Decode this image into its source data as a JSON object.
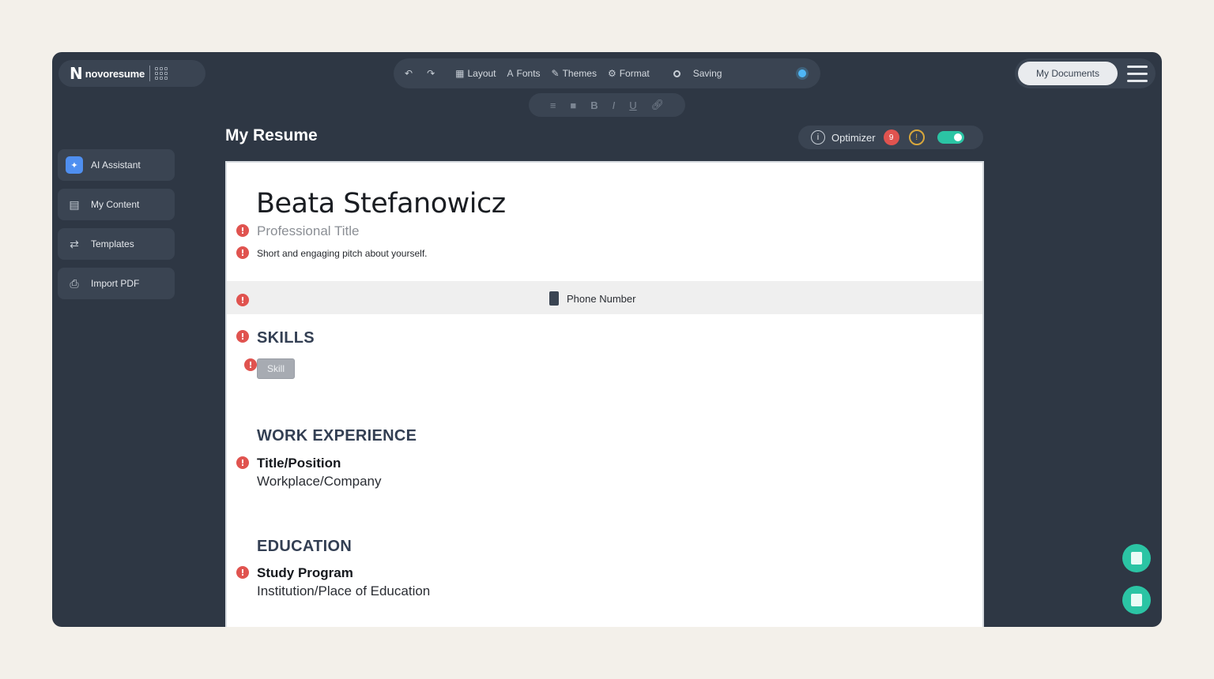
{
  "app": {
    "logo_mark": "N",
    "logo_text": "novoresume"
  },
  "toolbar": {
    "undo_icon": "undo-icon",
    "redo_icon": "redo-icon",
    "layout_label": "Layout",
    "fonts_label": "Fonts",
    "themes_label": "Themes",
    "format_label": "Format",
    "saving_label": "Saving"
  },
  "format_bar": {
    "bold": "B",
    "italic": "I",
    "underline": "U"
  },
  "header_right": {
    "my_documents_label": "My Documents"
  },
  "sidebar": {
    "items": [
      {
        "label": "AI Assistant",
        "icon": "ai-icon"
      },
      {
        "label": "My Content",
        "icon": "content-icon"
      },
      {
        "label": "Templates",
        "icon": "templates-icon"
      },
      {
        "label": "Import PDF",
        "icon": "import-pdf-icon"
      }
    ]
  },
  "main": {
    "title": "My Resume",
    "optimizer_label": "Optimizer",
    "optimizer_error_count": "9",
    "optimizer_warning": "!"
  },
  "resume": {
    "name": "Beata Stefanowicz",
    "professional_title": "Professional Title",
    "pitch": "Short and engaging pitch about yourself.",
    "phone_label": "Phone Number",
    "skills_heading": "SKILLS",
    "skill_chip": "Skill",
    "work_heading": "WORK EXPERIENCE",
    "work_title": "Title/Position",
    "work_company": "Workplace/Company",
    "education_heading": "EDUCATION",
    "edu_program": "Study Program",
    "edu_institution": "Institution/Place of Education",
    "error_mark": "!"
  },
  "colors": {
    "app_bg": "#2e3744",
    "accent_teal": "#2bc4a4",
    "error_red": "#e0534f",
    "heading_navy": "#333f53"
  }
}
